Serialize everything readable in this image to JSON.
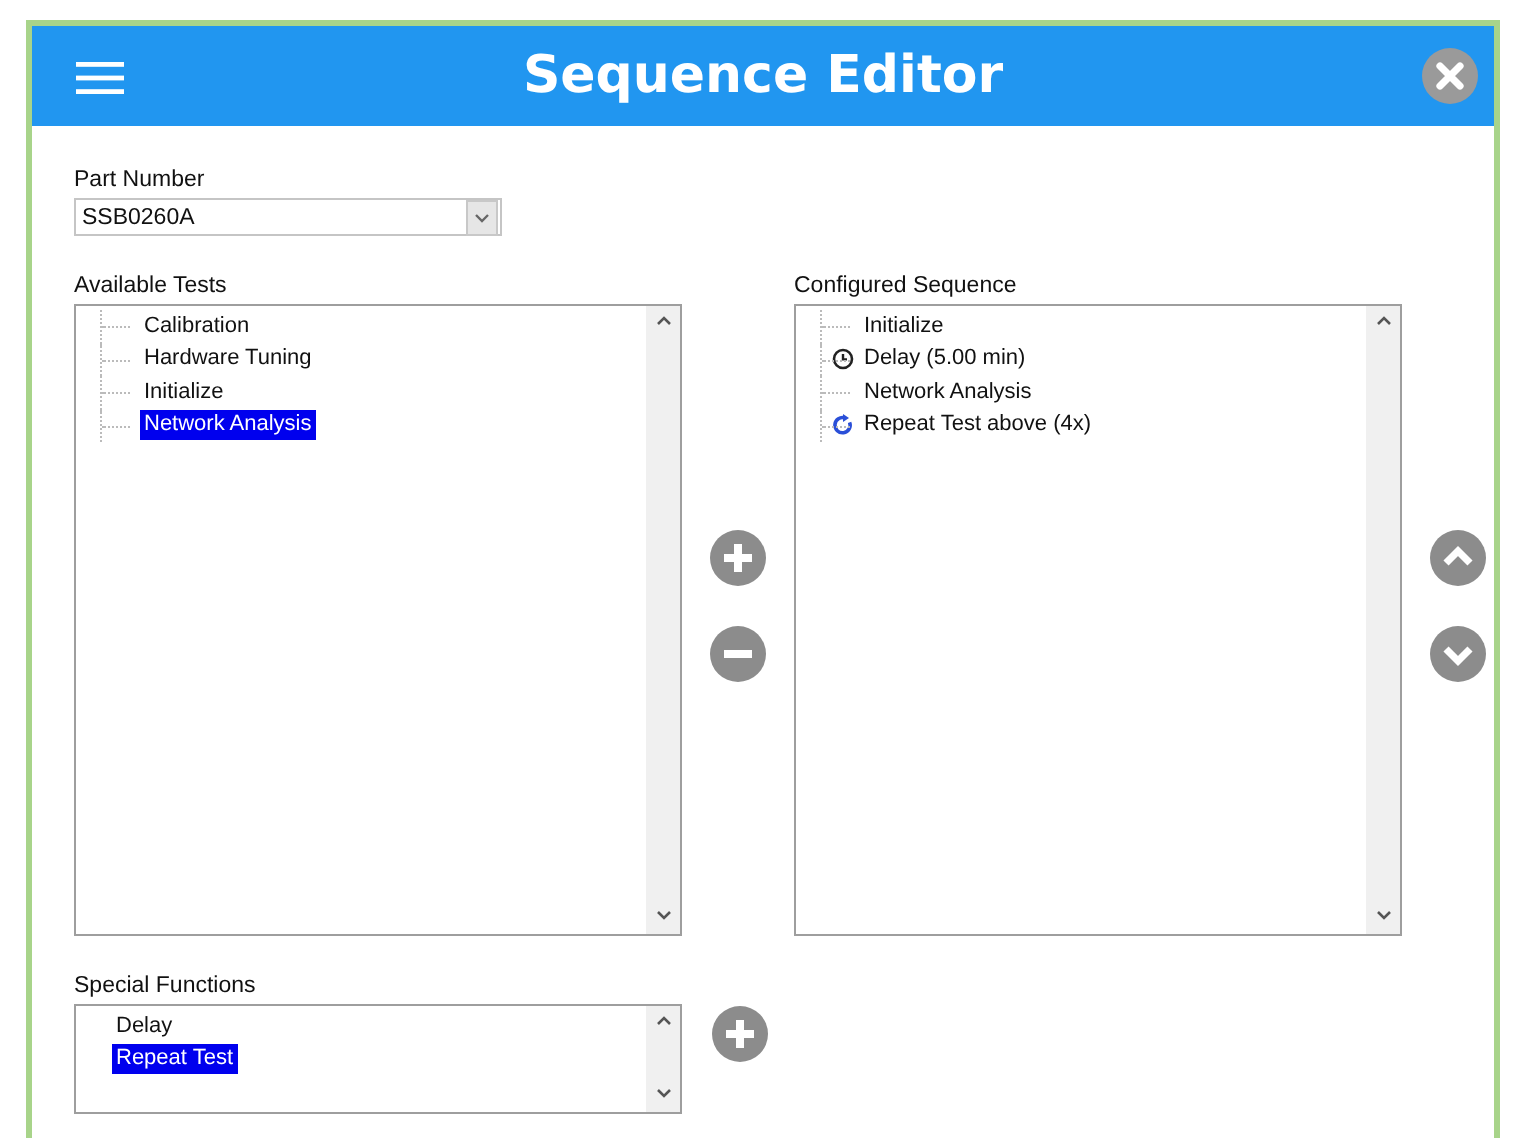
{
  "window": {
    "title": "Sequence Editor"
  },
  "part_number": {
    "label": "Part Number",
    "value": "SSB0260A"
  },
  "available_tests": {
    "label": "Available Tests",
    "items": [
      {
        "label": "Calibration",
        "selected": false
      },
      {
        "label": "Hardware Tuning",
        "selected": false
      },
      {
        "label": "Initialize",
        "selected": false
      },
      {
        "label": "Network Analysis",
        "selected": true
      }
    ]
  },
  "configured_sequence": {
    "label": "Configured Sequence",
    "items": [
      {
        "label": "Initialize",
        "kind": "test"
      },
      {
        "label": "Delay (5.00 min)",
        "kind": "delay"
      },
      {
        "label": "Network Analysis",
        "kind": "test"
      },
      {
        "label": "Repeat Test above (4x)",
        "kind": "repeat"
      }
    ]
  },
  "special_functions": {
    "label": "Special Functions",
    "items": [
      {
        "label": "Delay",
        "selected": false
      },
      {
        "label": "Repeat Test",
        "selected": true
      }
    ]
  }
}
